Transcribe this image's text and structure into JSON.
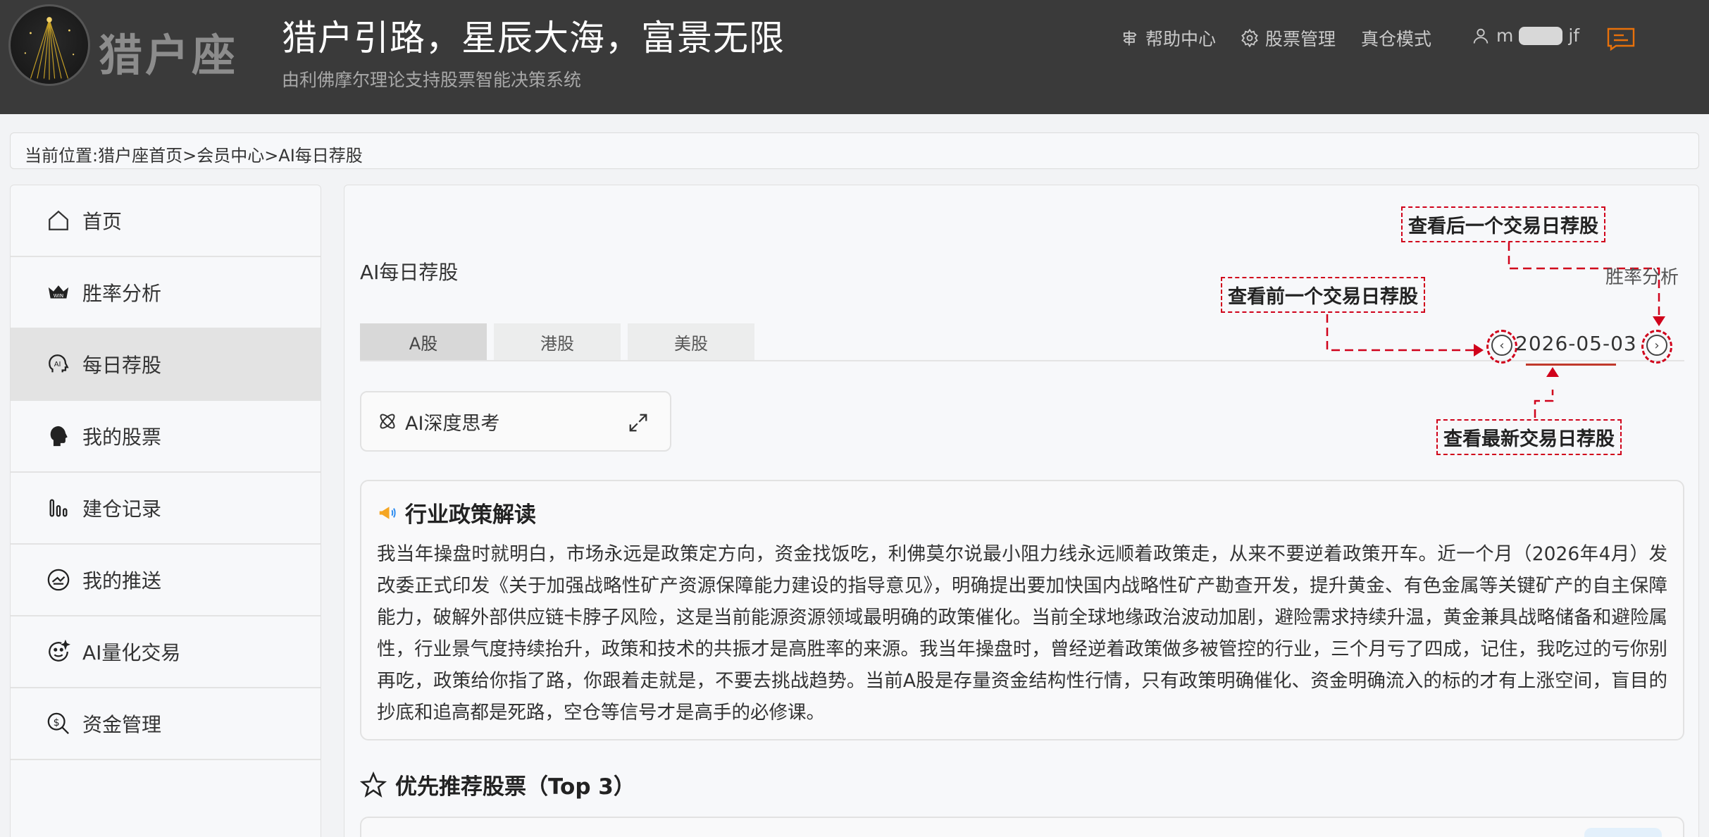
{
  "header": {
    "logo_text": "猎户座",
    "slogan": "猎户引路，星辰大海，富景无限",
    "subslogan": "由利佛摩尔理论支持股票智能决策系统",
    "nav": {
      "help": "帮助中心",
      "stock_manage": "股票管理",
      "real_mode": "真仓模式",
      "user_prefix": "m",
      "user_suffix": "jf"
    }
  },
  "breadcrumb": "当前位置:猎户座首页>会员中心>AI每日荐股",
  "sidebar": {
    "items": [
      {
        "label": "首页",
        "icon": "home-icon"
      },
      {
        "label": "胜率分析",
        "icon": "crown-win-icon"
      },
      {
        "label": "每日荐股",
        "icon": "ai-head-icon"
      },
      {
        "label": "我的股票",
        "icon": "head-profile-icon"
      },
      {
        "label": "建仓记录",
        "icon": "bar-chart-icon"
      },
      {
        "label": "我的推送",
        "icon": "push-icon"
      },
      {
        "label": "AI量化交易",
        "icon": "smile-ai-icon"
      },
      {
        "label": "资金管理",
        "icon": "money-search-icon"
      }
    ]
  },
  "main": {
    "title": "AI每日荐股",
    "tabs": [
      "A股",
      "港股",
      "美股"
    ],
    "active_tab": "A股",
    "date": "2026-05-03",
    "win_rate_link": "胜率分析",
    "annotations": {
      "next_day": "查看后一个交易日荐股",
      "prev_day": "查看前一个交易日荐股",
      "latest": "查看最新交易日荐股"
    },
    "think_label": "AI深度思考",
    "policy": {
      "title": "行业政策解读",
      "body": "我当年操盘时就明白，市场永远是政策定方向，资金找饭吃，利佛莫尔说最小阻力线永远顺着政策走，从来不要逆着政策开车。近一个月（2026年4月）发改委正式印发《关于加强战略性矿产资源保障能力建设的指导意见》，明确提出要加快国内战略性矿产勘查开发，提升黄金、有色金属等关键矿产的自主保障能力，破解外部供应链卡脖子风险，这是当前能源资源领域最明确的政策催化。当前全球地缘政治波动加剧，避险需求持续升温，黄金兼具战略储备和避险属性，行业景气度持续抬升，政策和技术的共振才是高胜率的来源。我当年操盘时，曾经逆着政策做多被管控的行业，三个月亏了四成，记住，我吃过的亏你别再吃，政策给你指了路，你跟着走就是，不要去挑战趋势。当前A股是存量资金结构性行情，只有政策明确催化、资金明确流入的标的才有上涨空间，盲目的抄底和追高都是死路，空仓等信号才是高手的必修课。"
    },
    "top_title": "优先推荐股票（Top 3）"
  },
  "colors": {
    "header_bg": "#3a3a3a",
    "annotation_red": "#d0021b",
    "accent_orange": "#e8710a"
  }
}
